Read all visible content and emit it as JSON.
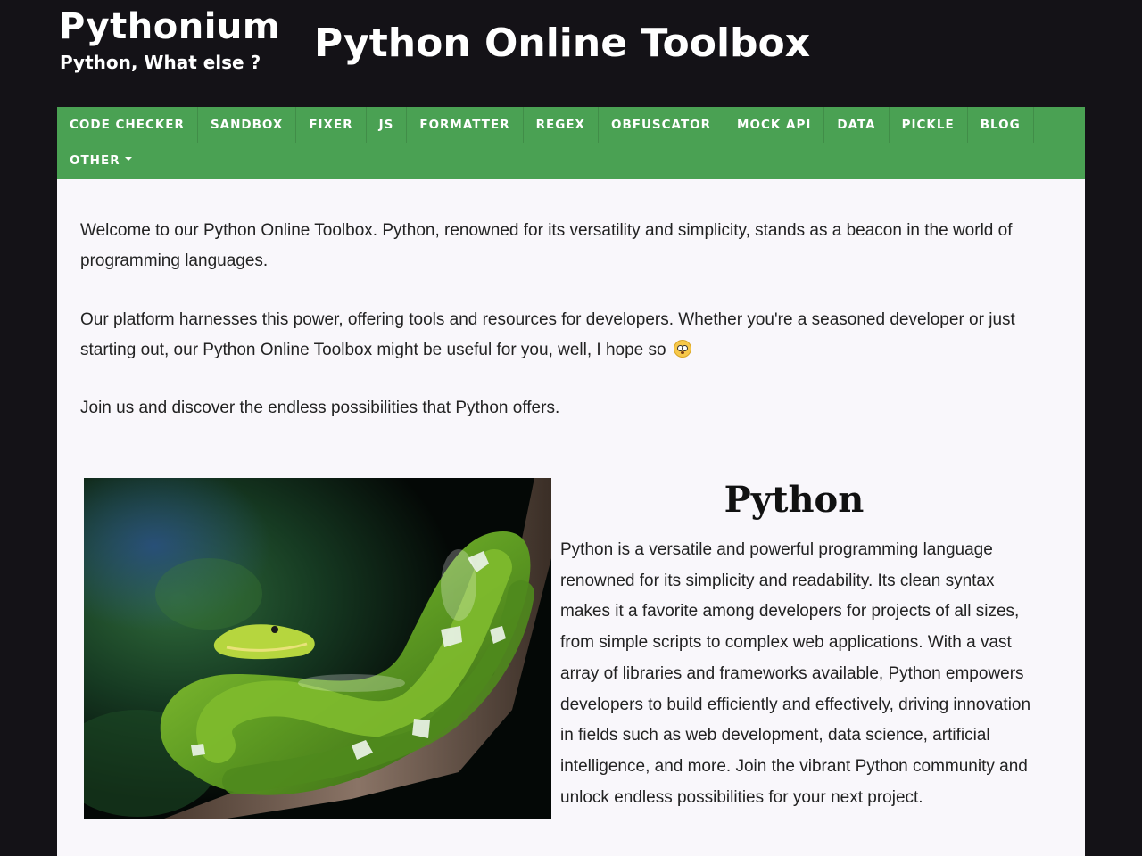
{
  "header": {
    "brand_name": "Pythonium",
    "brand_tagline": "Python, What else ?",
    "site_title": "Python Online Toolbox"
  },
  "nav": {
    "items": [
      {
        "label": "CODE CHECKER"
      },
      {
        "label": "SANDBOX"
      },
      {
        "label": "FIXER"
      },
      {
        "label": "JS"
      },
      {
        "label": "FORMATTER"
      },
      {
        "label": "REGEX"
      },
      {
        "label": "OBFUSCATOR"
      },
      {
        "label": "MOCK API"
      },
      {
        "label": "DATA"
      },
      {
        "label": "PICKLE"
      },
      {
        "label": "BLOG"
      }
    ],
    "other_label": "OTHER"
  },
  "intro": {
    "paragraph1": "Welcome to our Python Online Toolbox. Python, renowned for its versatility and simplicity, stands as a beacon in the world of programming languages.",
    "paragraph2": "Our platform harnesses this power, offering tools and resources for developers. Whether you're a seasoned developer or just starting out, our Python Online Toolbox might be useful for you, well, I hope so",
    "paragraph3": "Join us and discover the endless possibilities that Python offers."
  },
  "python_section": {
    "heading": "Python",
    "description": "Python is a versatile and powerful programming language renowned for its simplicity and readability. Its clean syntax makes it a favorite among developers for projects of all sizes, from simple scripts to complex web applications. With a vast array of libraries and frameworks available, Python empowers developers to build efficiently and effectively, driving innovation in fields such as web development, data science, artificial intelligence, and more. Join the vibrant Python community and unlock endless possibilities for your next project.",
    "image_icon": "green-python-snake-photo"
  },
  "colors": {
    "header_bg": "#141217",
    "nav_bg": "#4aa153",
    "content_bg": "#f9f7fb",
    "text": "#222222"
  }
}
